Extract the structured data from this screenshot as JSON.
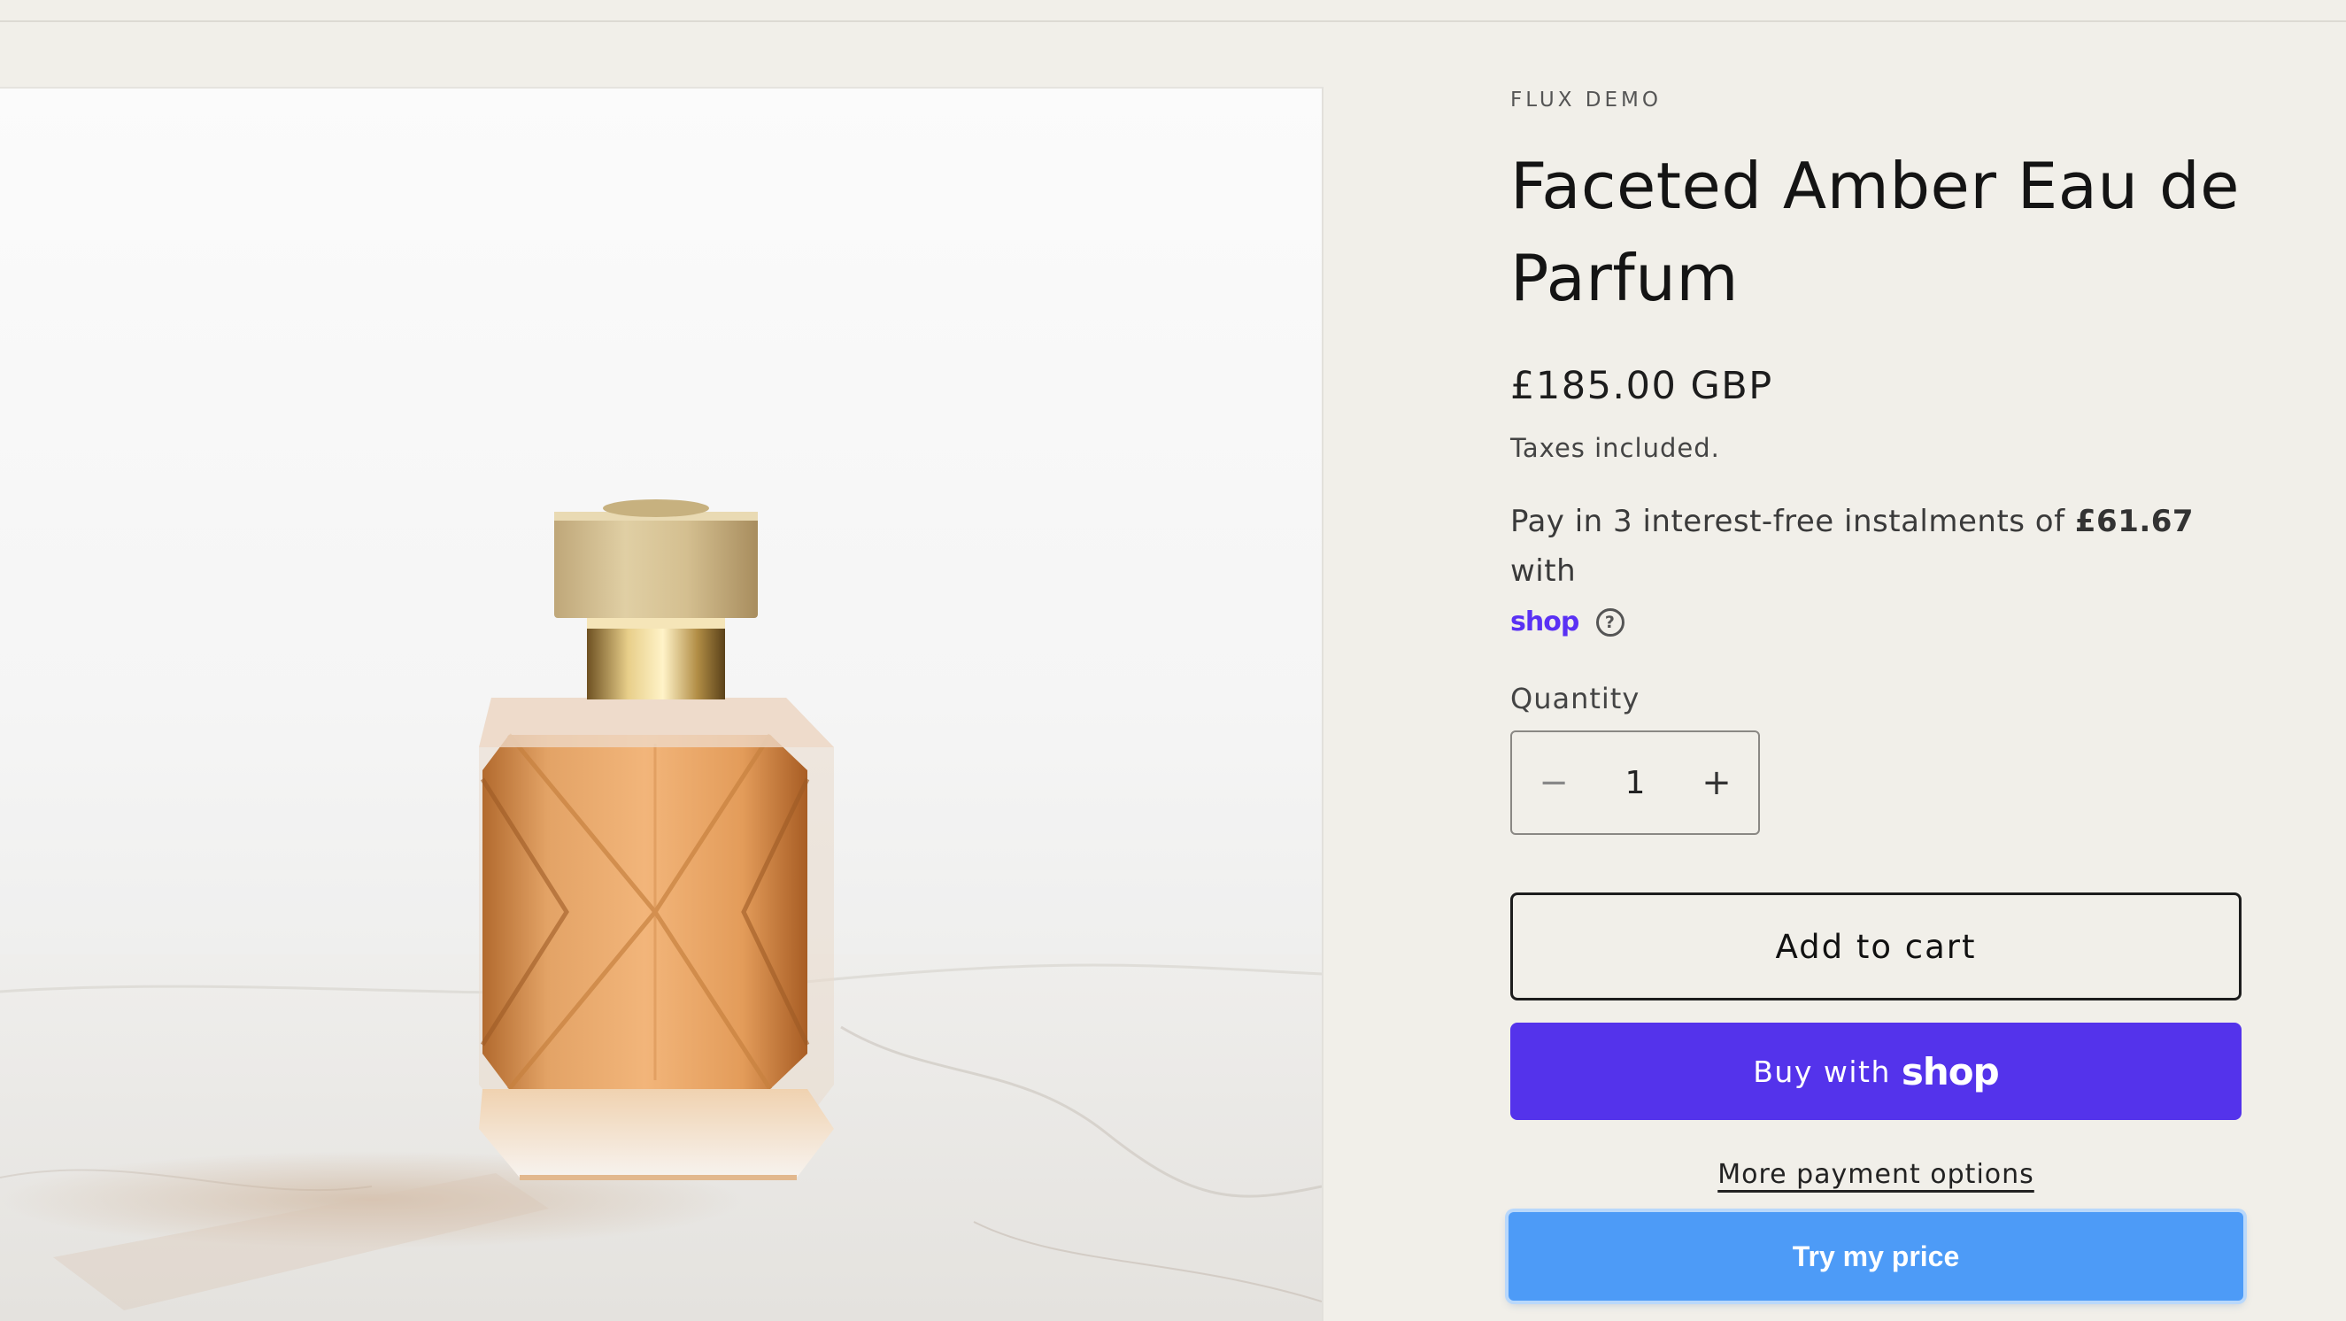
{
  "product": {
    "vendor": "FLUX DEMO",
    "title": "Faceted Amber Eau de Parfum",
    "price": "£185.00 GBP",
    "taxes_note": "Taxes included.",
    "image_alt": "Faceted amber perfume bottle with gold cap on marble surface"
  },
  "installments": {
    "text_before": "Pay in 3 interest-free instalments of ",
    "amount": "£61.67",
    "text_after": " with",
    "provider_logo": "shop",
    "help_glyph": "?"
  },
  "quantity": {
    "label": "Quantity",
    "value": "1",
    "decrease_glyph": "−",
    "increase_glyph": "+"
  },
  "actions": {
    "add_to_cart": "Add to cart",
    "buy_with_prefix": "Buy with",
    "buy_with_brand": "shop",
    "more_payment_options": "More payment options",
    "try_my_price": "Try my price"
  },
  "colors": {
    "page_background": "#f1efe9",
    "shop_purple": "#5433eb",
    "try_price_blue": "#4d9bf7"
  }
}
